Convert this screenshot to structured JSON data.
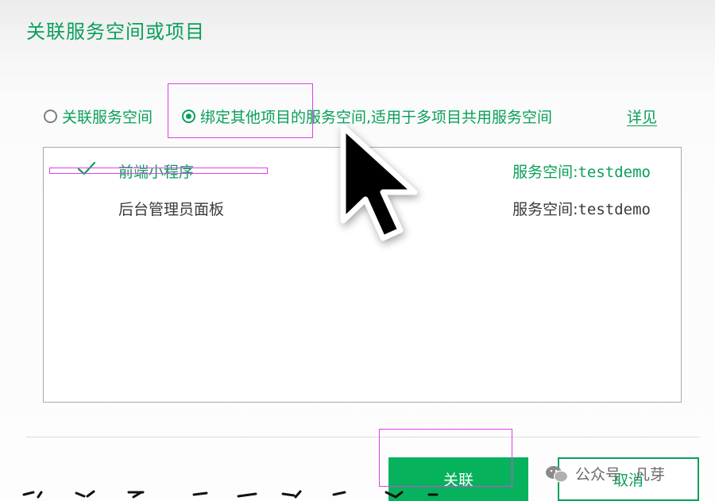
{
  "dialog": {
    "title": "关联服务空间或项目"
  },
  "mode_options": [
    {
      "label": "关联服务空间",
      "checked": false
    },
    {
      "label": "绑定其他项目的服务空间,适用于多项目共用服务空间",
      "checked": true
    }
  ],
  "details_link": "详见",
  "projects": [
    {
      "name": "前端小程序",
      "space_prefix": "服务空间:",
      "space_value": "testdemo",
      "selected": true
    },
    {
      "name": "后台管理员面板",
      "space_prefix": "服务空间:",
      "space_value": "testdemo",
      "selected": false
    }
  ],
  "buttons": {
    "confirm": "关联",
    "cancel": "取消"
  },
  "watermark": {
    "source": "公众号",
    "author": "凡芽"
  },
  "colors": {
    "accent": "#0aa05a",
    "button_primary": "#07b25c",
    "annotation": "#e040e8"
  },
  "icons": [
    "check-icon",
    "mouse-pointer-icon",
    "wechat-icon"
  ]
}
